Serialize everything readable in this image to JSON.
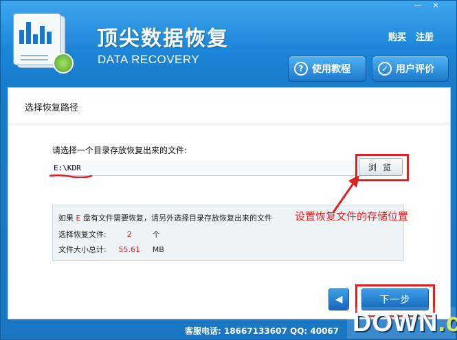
{
  "header": {
    "title": "顶尖数据恢复",
    "subtitle": "DATA RECOVERY",
    "links": {
      "buy": "购买",
      "register": "注册"
    },
    "window_controls": {
      "minimize": "—",
      "close": "×"
    },
    "buttons": {
      "tutorial": "使用教程",
      "rating": "用户评价"
    },
    "colors": {
      "accent": "#1d86d8"
    }
  },
  "main": {
    "step_title": "选择恢复路径",
    "prompt": "请选择一个目录存放恢复出来的文件:",
    "path_value": "E:\\KDR",
    "browse_label": "浏 览",
    "info": {
      "line1_prefix": "如果",
      "drive": "E",
      "line1_suffix": "盘有文件需要恢复，请另外选择目录存放恢复出来的文件",
      "selected_label": "选择恢复文件:",
      "selected_count": "2",
      "selected_unit": "个",
      "size_label": "文件大小总计:",
      "size_value": "55.61",
      "size_unit": "MB"
    },
    "back_label": "◀",
    "next_label": "下一步"
  },
  "annotation": {
    "text": "设置恢复文件的存储位置",
    "color": "#e02020"
  },
  "footer": {
    "text": "客服电话: 18667133607 QQ: 40067"
  },
  "watermark": {
    "text": "DOWN",
    "suffix": ".cc"
  }
}
